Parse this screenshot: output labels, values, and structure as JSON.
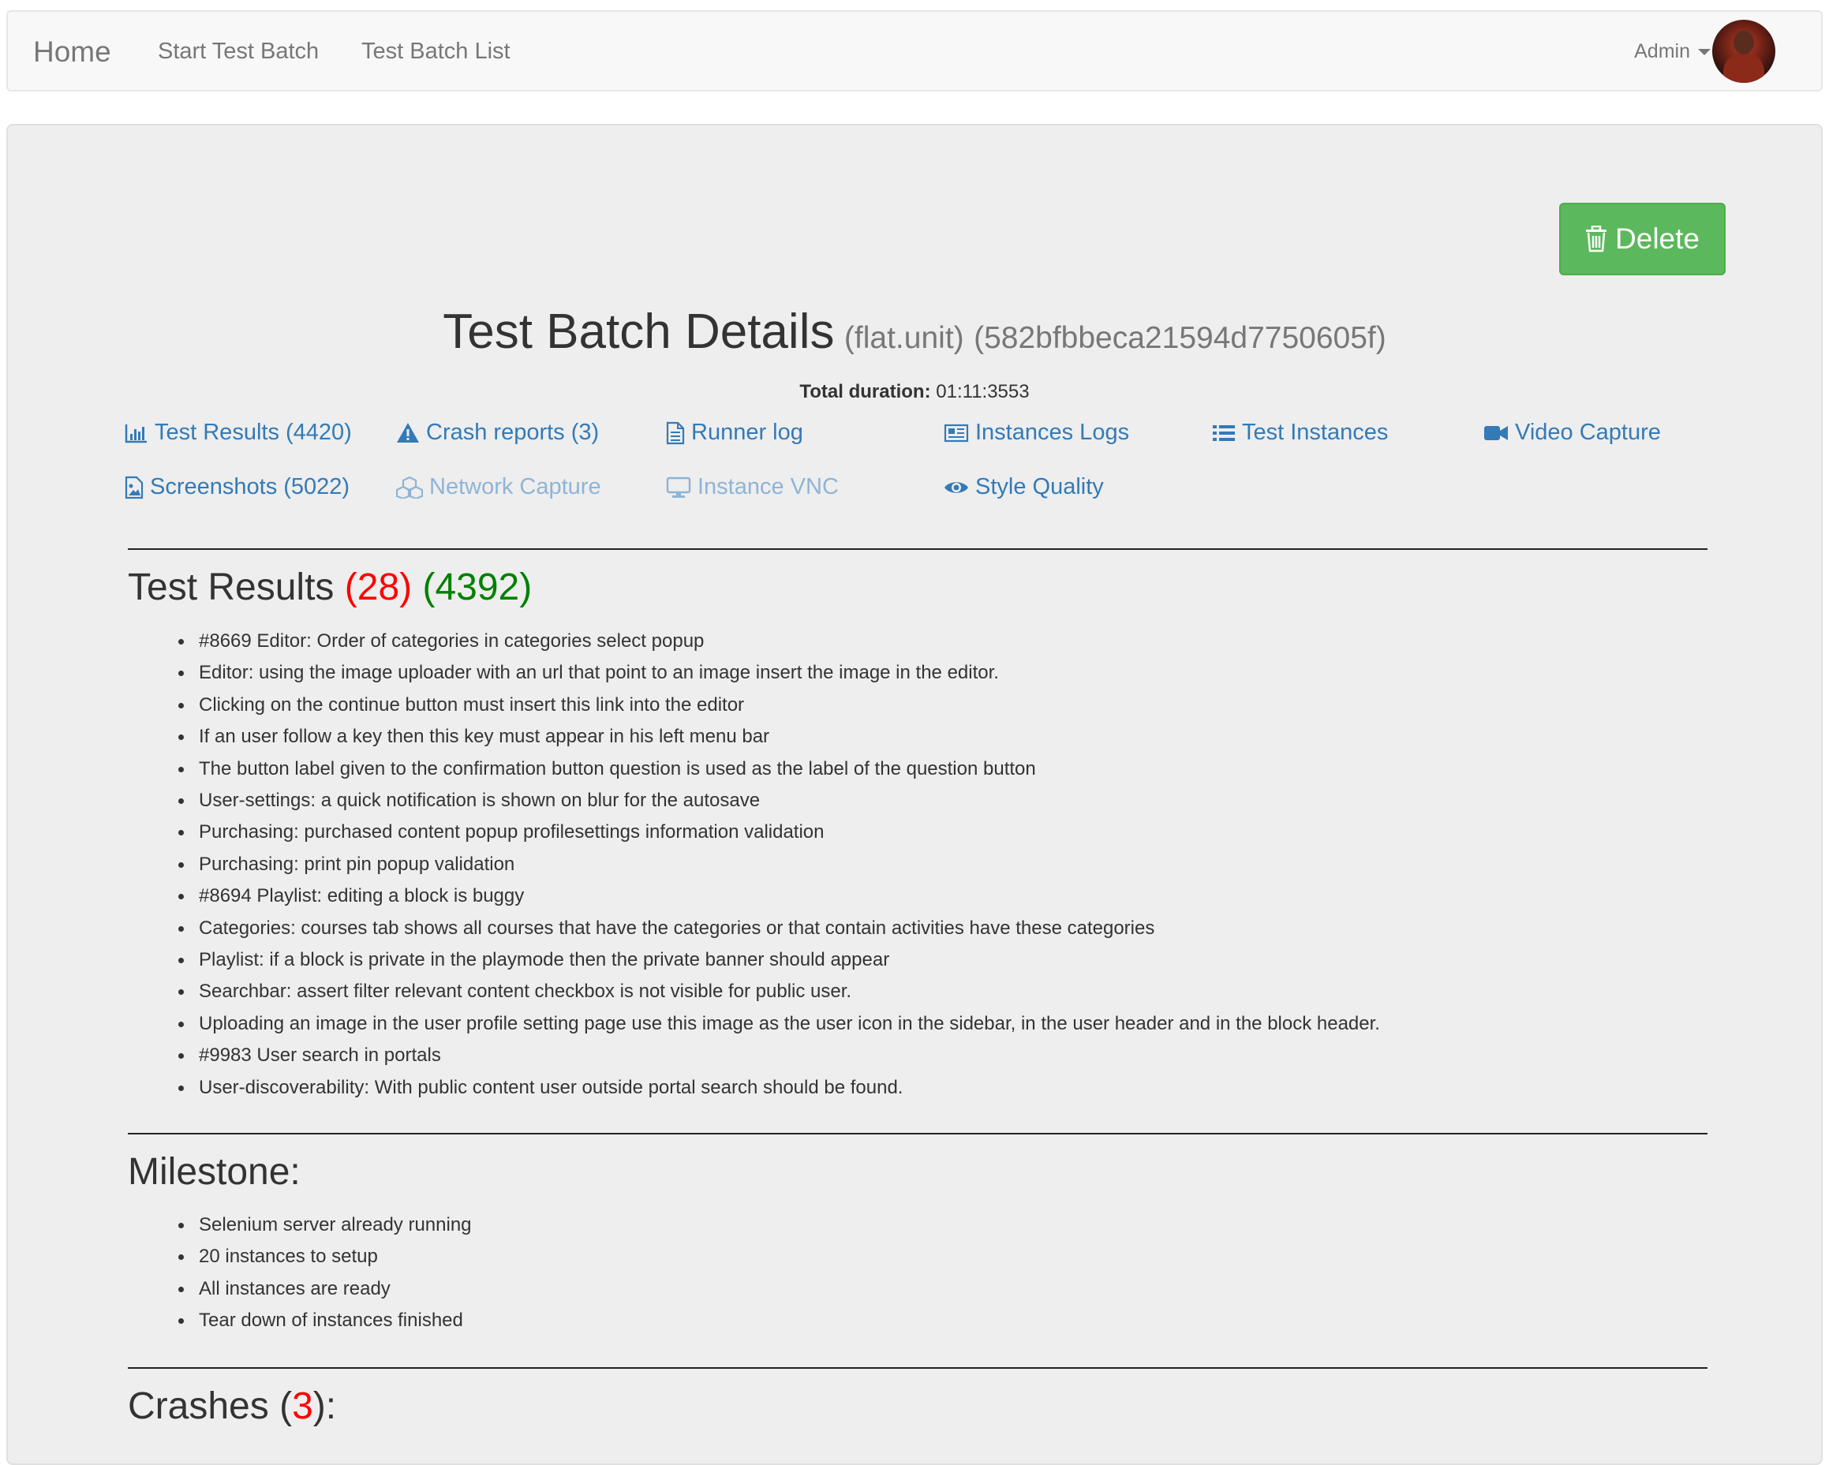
{
  "navbar": {
    "brand": "Home",
    "links": [
      "Start Test Batch",
      "Test Batch List"
    ],
    "user": "Admin"
  },
  "actions": {
    "delete_label": "Delete"
  },
  "header": {
    "title": "Test Batch Details",
    "subtitle_type": "(flat.unit)",
    "subtitle_id": "(582bfbbeca21594d7750605f)",
    "duration_label": "Total duration:",
    "duration_value": "01:11:3553"
  },
  "links": {
    "test_results": "Test Results (4420)",
    "crash_reports": "Crash reports (3)",
    "runner_log": "Runner log",
    "instances_logs": "Instances Logs",
    "test_instances": "Test Instances",
    "video_capture": "Video Capture",
    "screenshots": "Screenshots (5022)",
    "network_capture": "Network Capture",
    "instance_vnc": "Instance VNC",
    "style_quality": "Style Quality"
  },
  "test_results": {
    "title": "Test Results",
    "failed": "(28)",
    "passed": "(4392)",
    "items": [
      "#8669 Editor: Order of categories in categories select popup",
      "Editor: using the image uploader with an url that point to an image insert the image in the editor.",
      "Clicking on the continue button must insert this link into the editor",
      "If an user follow a key then this key must appear in his left menu bar",
      "The button label given to the confirmation button question is used as the label of the question button",
      "User-settings: a quick notification is shown on blur for the autosave",
      "Purchasing: purchased content popup profilesettings information validation",
      "Purchasing: print pin popup validation",
      "#8694 Playlist: editing a block is buggy",
      "Categories: courses tab shows all courses that have the categories or that contain activities have these categories",
      "Playlist: if a block is private in the playmode then the private banner should appear",
      "Searchbar: assert filter relevant content checkbox is not visible for public user.",
      "Uploading an image in the user profile setting page use this image as the user icon in the sidebar, in the user header and in the block header.",
      "#9983 User search in portals",
      "User-discoverability: With public content user outside portal search should be found."
    ]
  },
  "milestone": {
    "title": "Milestone:",
    "items": [
      "Selenium server already running",
      "20 instances to setup",
      "All instances are ready",
      "Tear down of instances finished"
    ]
  },
  "crashes": {
    "title_prefix": "Crashes (",
    "count": "3",
    "title_suffix": "):"
  },
  "colors": {
    "link": "#337ab7",
    "success": "#5cb85c",
    "failed": "#ff0000",
    "passed": "#008000"
  }
}
